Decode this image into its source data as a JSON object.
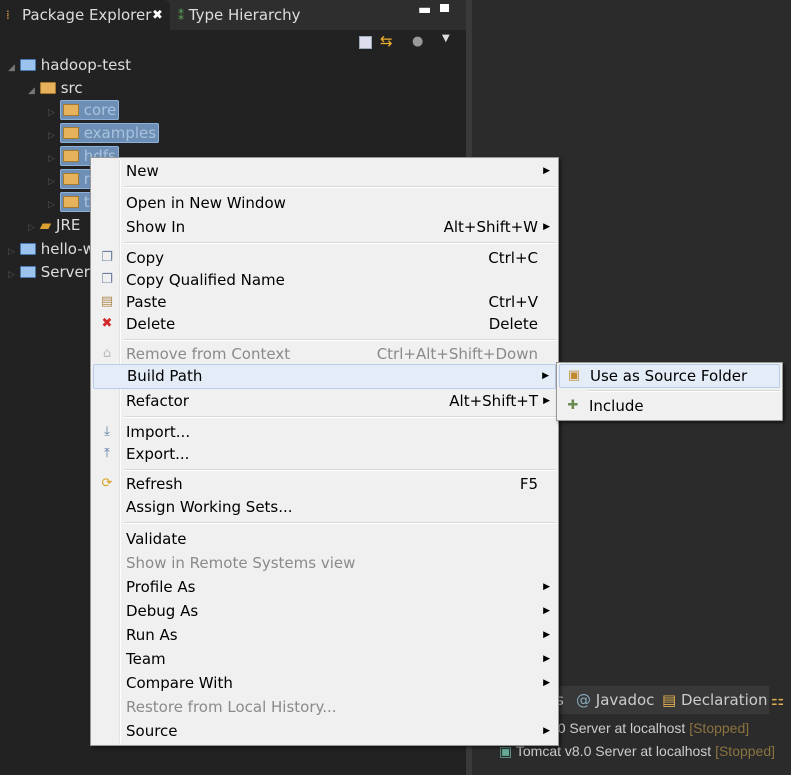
{
  "tabs": [
    {
      "label": "Package Explorer",
      "active": true
    },
    {
      "label": "Type Hierarchy",
      "active": false
    }
  ],
  "tree": {
    "project1": "hadoop-test",
    "src": "src",
    "folders": [
      "core",
      "examples",
      "hdfs",
      "mapred",
      "test"
    ],
    "jre": "JRE",
    "project2": "hello-w",
    "servers": "Server"
  },
  "menu": {
    "items": [
      {
        "label": "New",
        "submenu": true
      },
      {
        "label": "Open in New Window"
      },
      {
        "label": "Show In",
        "shortcut": "Alt+Shift+W",
        "submenu": true
      },
      {
        "label": "Copy",
        "shortcut": "Ctrl+C",
        "icon": "copy-icon"
      },
      {
        "label": "Copy Qualified Name",
        "icon": "copy-qualified-icon"
      },
      {
        "label": "Paste",
        "shortcut": "Ctrl+V",
        "icon": "paste-icon"
      },
      {
        "label": "Delete",
        "shortcut": "Delete",
        "icon": "delete-icon"
      },
      {
        "label": "Remove from Context",
        "shortcut": "Ctrl+Alt+Shift+Down",
        "disabled": true
      },
      {
        "label": "Build Path",
        "submenu": true,
        "highlighted": true
      },
      {
        "label": "Refactor",
        "shortcut": "Alt+Shift+T",
        "submenu": true
      },
      {
        "label": "Import...",
        "icon": "import-icon"
      },
      {
        "label": "Export...",
        "icon": "export-icon"
      },
      {
        "label": "Refresh",
        "shortcut": "F5",
        "icon": "refresh-icon"
      },
      {
        "label": "Assign Working Sets..."
      },
      {
        "label": "Validate"
      },
      {
        "label": "Show in Remote Systems view",
        "disabled": true
      },
      {
        "label": "Profile As",
        "submenu": true
      },
      {
        "label": "Debug As",
        "submenu": true
      },
      {
        "label": "Run As",
        "submenu": true
      },
      {
        "label": "Team",
        "submenu": true
      },
      {
        "label": "Compare With",
        "submenu": true
      },
      {
        "label": "Restore from Local History...",
        "disabled": true
      },
      {
        "label": "Source",
        "submenu": true
      }
    ]
  },
  "submenu": {
    "items": [
      {
        "label": "Use as Source Folder",
        "highlighted": true
      },
      {
        "label": "Include"
      }
    ]
  },
  "bottom": {
    "tabs": [
      "s",
      "Javadoc",
      "Declaration"
    ],
    "servers": [
      {
        "name": "Tomcat v7.0 Server at localhost",
        "status": "[Stopped]"
      },
      {
        "name": "Tomcat v8.0 Server at localhost",
        "status": "[Stopped]"
      }
    ]
  }
}
